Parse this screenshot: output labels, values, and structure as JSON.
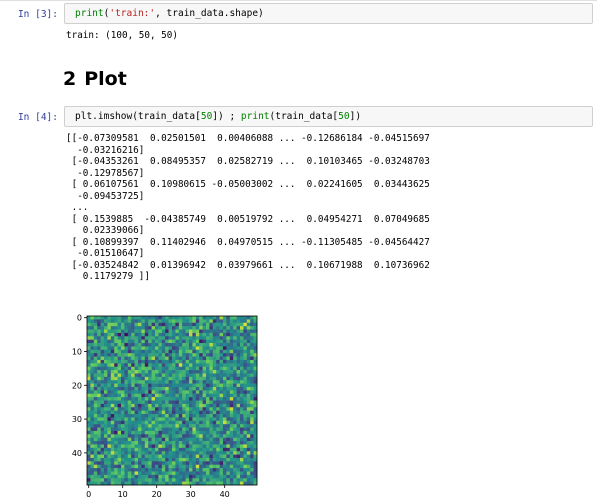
{
  "cells": [
    {
      "prompt": "In [3]:",
      "code": {
        "fn": "print",
        "open": "(",
        "str": "'train:'",
        "rest": ", train_data.shape)"
      },
      "output": "train: (100, 50, 50)"
    },
    {
      "prompt": "In [4]:",
      "code": {
        "fn": "plt.imshow",
        "open": "(train_data[",
        "num": "50",
        "mid": "]) ; ",
        "fn2": "print",
        "open2": "(train_data[",
        "num2": "50",
        "close": "])"
      },
      "output_lines": [
        "[[-0.07309581  0.02501501  0.00406088 ... -0.12686184 -0.04515697",
        "  -0.03216216]",
        " [-0.04353261  0.08495357  0.02582719 ...  0.10103465 -0.03248703",
        "  -0.12978567]",
        " [ 0.06107561  0.10980615 -0.05003002 ...  0.02241605  0.03443625",
        "  -0.09453725]",
        " ...",
        " [ 0.1539885  -0.04385749  0.00519792 ...  0.04954271  0.07049685",
        "   0.02339066]",
        " [ 0.10899397  0.11402946  0.04970515 ... -0.11305485 -0.04564427",
        "  -0.01510647]",
        " [-0.03524842  0.01396942  0.03979661 ...  0.10671988  0.10736962",
        "   0.1179279 ]]"
      ]
    }
  ],
  "heading": {
    "number": "2",
    "title": "Plot"
  },
  "chart_data": {
    "type": "heatmap",
    "rows": 50,
    "cols": 50,
    "colormap": "viridis",
    "xticks": [
      "0",
      "10",
      "20",
      "30",
      "40"
    ],
    "yticks": [
      "0",
      "10",
      "20",
      "30",
      "40"
    ]
  }
}
